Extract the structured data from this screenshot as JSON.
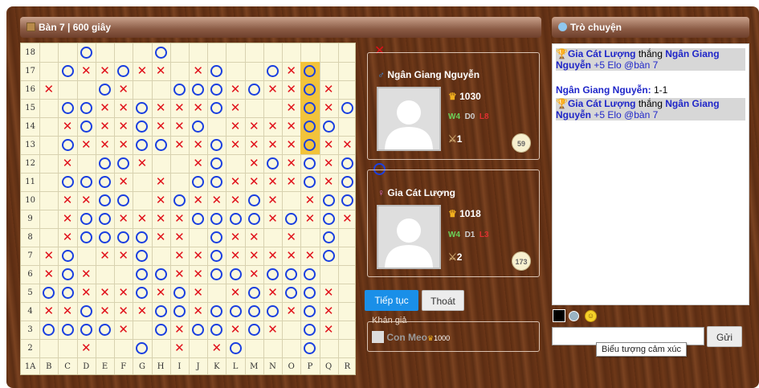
{
  "board_header": {
    "title": "Bàn 7 | 600 giây"
  },
  "chat_header": {
    "title": "Trò chuyện"
  },
  "board": {
    "row_labels": [
      "18",
      "17",
      "16",
      "15",
      "14",
      "13",
      "12",
      "11",
      "10",
      "9",
      "8",
      "7",
      "6",
      "5",
      "4",
      "3",
      "2"
    ],
    "col_labels": [
      "1A",
      "B",
      "C",
      "D",
      "E",
      "F",
      "G",
      "H",
      "I",
      "J",
      "K",
      "L",
      "M",
      "N",
      "O",
      "P",
      "Q",
      "R"
    ],
    "rows": [
      "...O...O..........",
      "..OXXOXX.XO..OXO..",
      ".X..OX..OOOXOXXOX.",
      "..OOXXOXXXOX..XOXOX",
      "..XOXXOXXO.XXXXOO.",
      "..OXXXOOXXOXXXXOXX",
      "..X.OOX..XO.XOXOXO",
      "..OOOX.X.OOXXXXOXO",
      "..XXOO.XOXXXOX.XOO",
      "..XOOXXXXOOOOXOXOX",
      "..XOOOOXX.OXX.X.O.",
      ".XO.XXO.XXOXXXXXO.",
      ".XOX..OOXXOOXOOO..",
      ".OOXXXOXOX.XOXOOX.",
      ".XXOXXXOOXOOOOXOX.",
      ".OOOOX.OXOOXOX.OX.",
      "...X..O.X.XO...O.."
    ],
    "highlight_column": "P",
    "highlight_rows": [
      "17",
      "16",
      "15",
      "14",
      "13"
    ]
  },
  "player1": {
    "mark": "X",
    "gender_icon": "male-icon",
    "name": "Ngân Giang Nguyễn",
    "elo": "1030",
    "w": "W4",
    "d": "D0",
    "l": "L8",
    "wins_icon": "1",
    "time": "59"
  },
  "player2": {
    "mark": "O",
    "gender_icon": "female-icon",
    "name": "Gia Cát Lượng",
    "elo": "1018",
    "w": "W4",
    "d": "D1",
    "l": "L3",
    "wins_icon": "2",
    "time": "173"
  },
  "buttons": {
    "continue": "Tiếp tục",
    "quit": "Thoát",
    "send": "Gửi"
  },
  "spectators": {
    "title": "Khán giả",
    "items": [
      {
        "name": "Con Meo",
        "elo": "1000"
      }
    ]
  },
  "chat": {
    "messages": [
      {
        "type": "system",
        "winner": "Gia Cát Lượng",
        "verb": " thắng ",
        "loser": "Ngân Giang Nguyễn",
        "rest": " +5 Elo @bàn 7"
      },
      {
        "type": "user",
        "user": "Ngân Giang Nguyễn:",
        "text": " 1-1"
      },
      {
        "type": "system",
        "winner": "Gia Cát Lượng",
        "verb": " thắng ",
        "loser": "Ngân Giang Nguyễn",
        "rest": " +5 Elo @bàn 7"
      }
    ],
    "input_placeholder": "",
    "tooltip": "Biểu tượng cảm xúc"
  },
  "colors": {
    "x": "#e0101a",
    "o": "#1a3fe0",
    "highlight": "#f2c33b",
    "wood": "#6e3818"
  }
}
